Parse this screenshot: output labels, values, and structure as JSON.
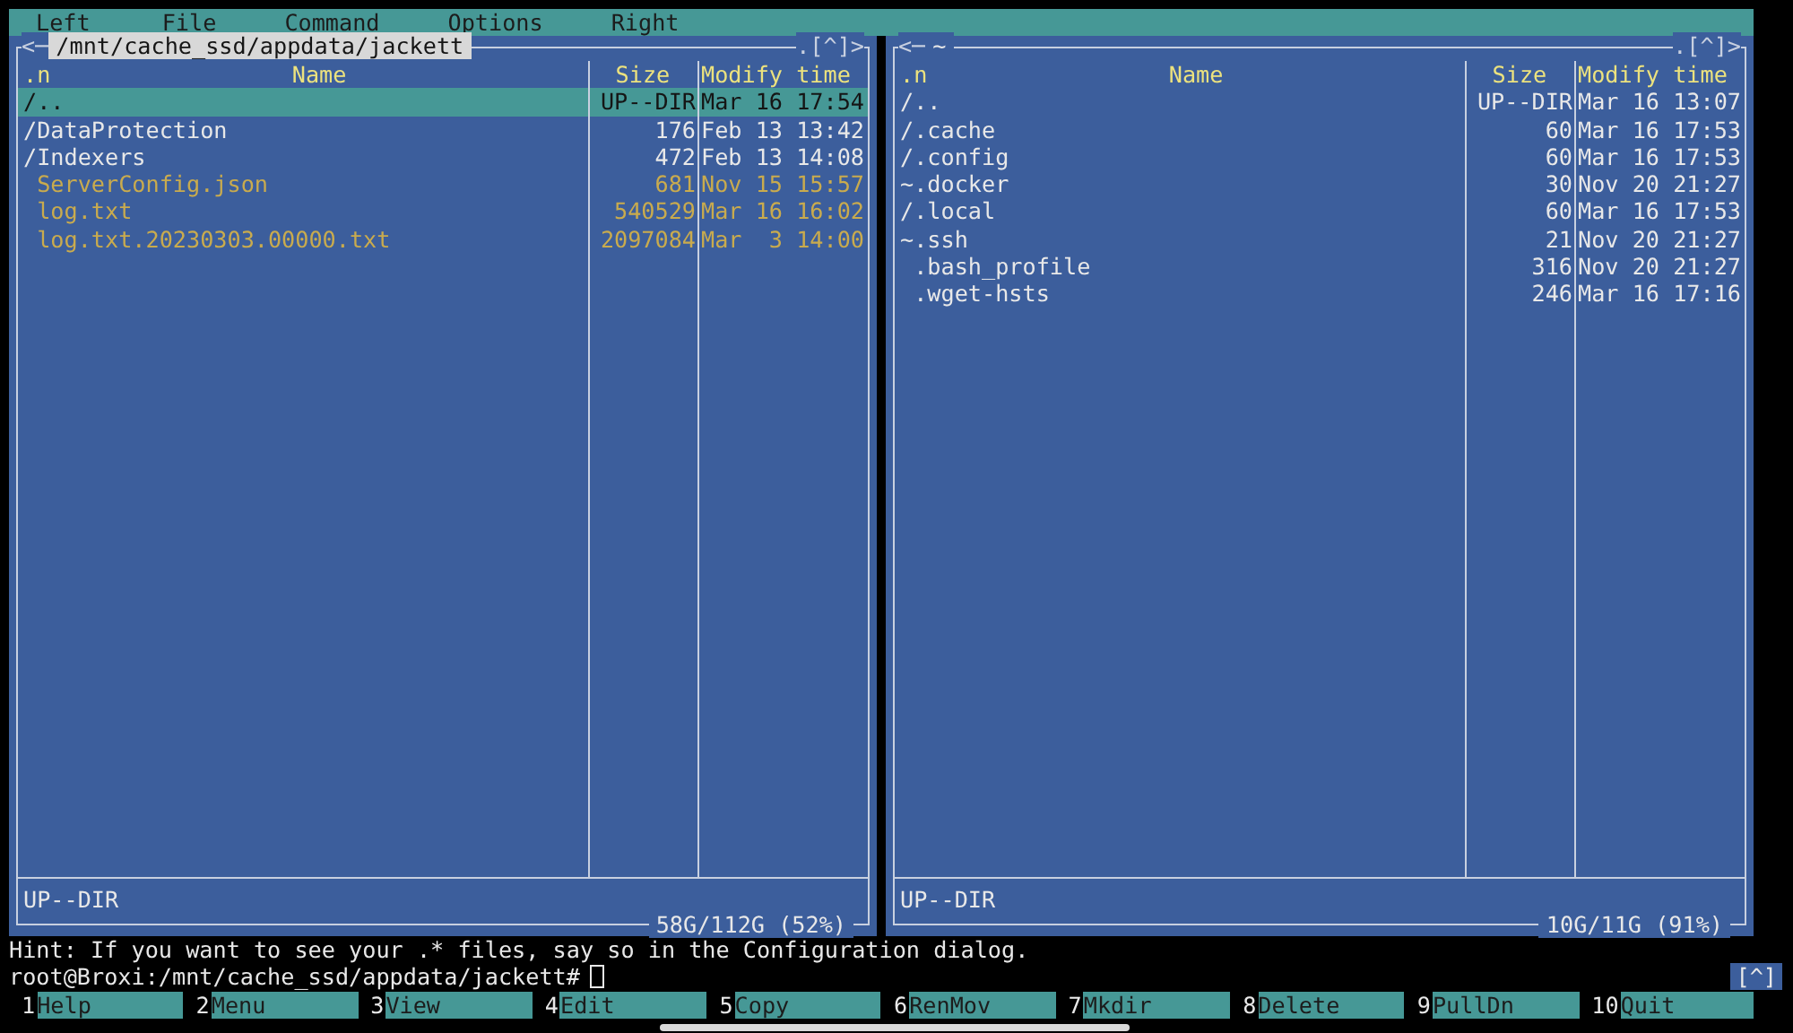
{
  "menu_bar": [
    "Left",
    "File",
    "Command",
    "Options",
    "Right"
  ],
  "panels": [
    {
      "nav_left": "<─",
      "path": "/mnt/cache_ssd/appdata/jackett",
      "active": true,
      "nav_right": ".[^]>",
      "columns": [
        ".n",
        "Name",
        "Size",
        "Modify time"
      ],
      "rows": [
        {
          "name": "/..",
          "size": "UP--DIR",
          "time": "Mar 16 17:54",
          "kind": "dir",
          "selected": true
        },
        {
          "name": "/DataProtection",
          "size": "176",
          "time": "Feb 13 13:42",
          "kind": "dir",
          "selected": false
        },
        {
          "name": "/Indexers",
          "size": "472",
          "time": "Feb 13 14:08",
          "kind": "dir",
          "selected": false
        },
        {
          "name": " ServerConfig.json",
          "size": "681",
          "time": "Nov 15 15:57",
          "kind": "file",
          "selected": false
        },
        {
          "name": " log.txt",
          "size": "540529",
          "time": "Mar 16 16:02",
          "kind": "file",
          "selected": false
        },
        {
          "name": " log.txt.20230303.00000.txt",
          "size": "2097084",
          "time": "Mar  3 14:00",
          "kind": "file",
          "selected": false
        }
      ],
      "status": "UP--DIR",
      "free": "58G/112G (52%)"
    },
    {
      "nav_left": "<─",
      "path": "~",
      "active": false,
      "nav_right": ".[^]>",
      "columns": [
        ".n",
        "Name",
        "Size",
        "Modify time"
      ],
      "rows": [
        {
          "name": "/..",
          "size": "UP--DIR",
          "time": "Mar 16 13:07",
          "kind": "dir",
          "selected": false
        },
        {
          "name": "/.cache",
          "size": "60",
          "time": "Mar 16 17:53",
          "kind": "dir",
          "selected": false
        },
        {
          "name": "/.config",
          "size": "60",
          "time": "Mar 16 17:53",
          "kind": "dir",
          "selected": false
        },
        {
          "name": "~.docker",
          "size": "30",
          "time": "Nov 20 21:27",
          "kind": "dir",
          "selected": false
        },
        {
          "name": "/.local",
          "size": "60",
          "time": "Mar 16 17:53",
          "kind": "dir",
          "selected": false
        },
        {
          "name": "~.ssh",
          "size": "21",
          "time": "Nov 20 21:27",
          "kind": "dir",
          "selected": false
        },
        {
          "name": " .bash_profile",
          "size": "316",
          "time": "Nov 20 21:27",
          "kind": "dotfile",
          "selected": false
        },
        {
          "name": " .wget-hsts",
          "size": "246",
          "time": "Mar 16 17:16",
          "kind": "dotfile",
          "selected": false
        }
      ],
      "status": "UP--DIR",
      "free": "10G/11G (91%)"
    }
  ],
  "hint": "Hint: If you want to see your .* files, say so in the Configuration dialog.",
  "prompt": "root@Broxi:/mnt/cache_ssd/appdata/jackett#",
  "prompt_indicator": "[^]",
  "function_keys": [
    {
      "number": "1",
      "label": "Help"
    },
    {
      "number": "2",
      "label": "Menu"
    },
    {
      "number": "3",
      "label": "View"
    },
    {
      "number": "4",
      "label": "Edit"
    },
    {
      "number": "5",
      "label": "Copy"
    },
    {
      "number": "6",
      "label": "RenMov"
    },
    {
      "number": "7",
      "label": "Mkdir"
    },
    {
      "number": "8",
      "label": "Delete"
    },
    {
      "number": "9",
      "label": "PullDn"
    },
    {
      "number": "10",
      "label": "Quit"
    }
  ]
}
